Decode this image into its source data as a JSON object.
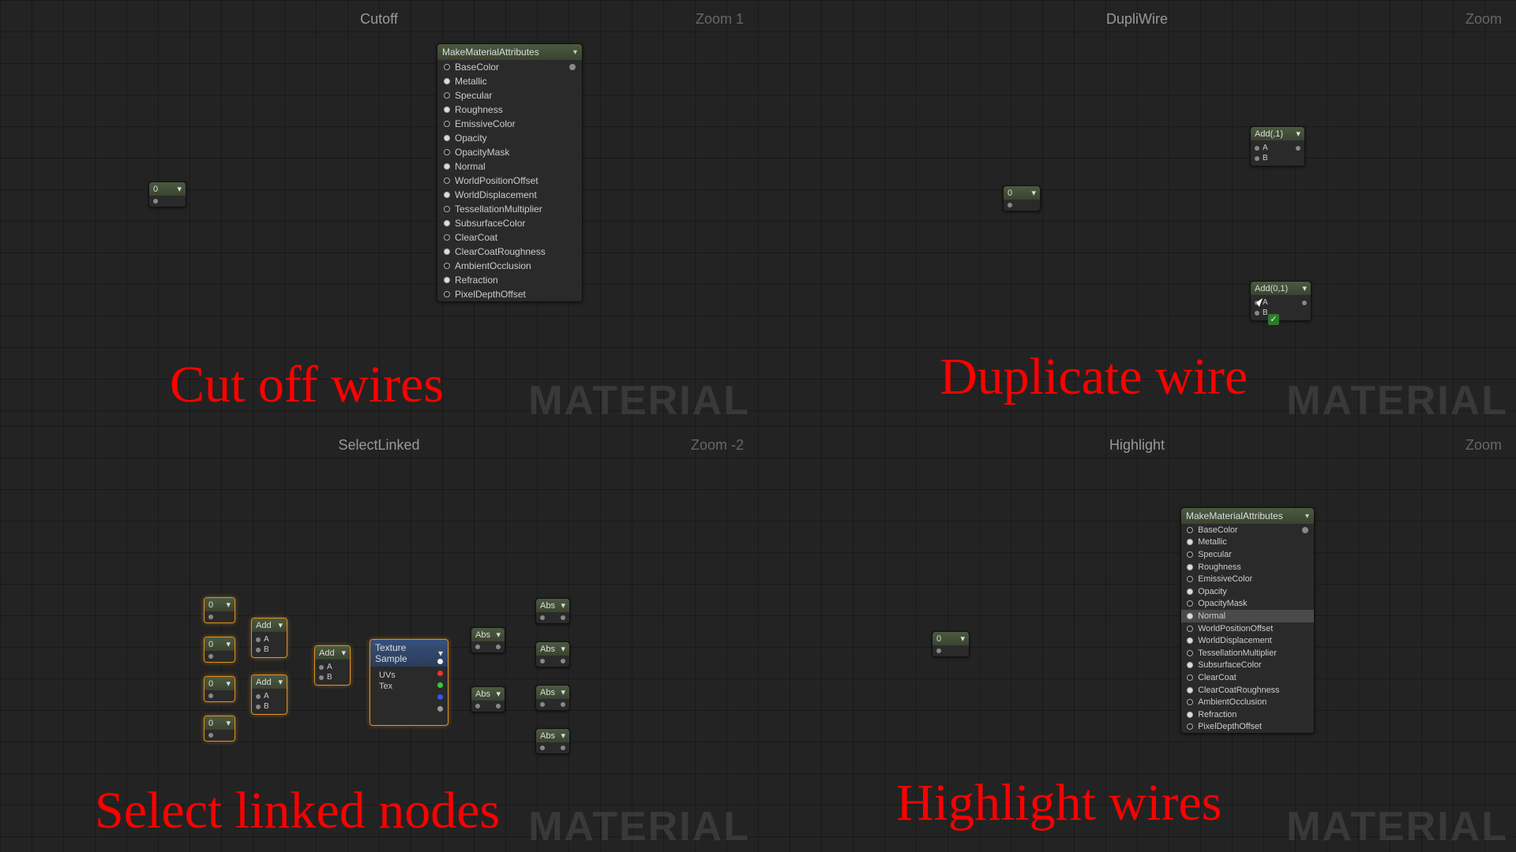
{
  "watermark": "MATERIAL",
  "quadrants": {
    "tl": {
      "title": "Cutoff",
      "zoom": "Zoom 1",
      "caption": "Cut off wires"
    },
    "tr": {
      "title": "DupliWire",
      "zoom": "Zoom",
      "caption": "Duplicate wire"
    },
    "bl": {
      "title": "SelectLinked",
      "zoom": "Zoom -2",
      "caption": "Select linked nodes"
    },
    "br": {
      "title": "Highlight",
      "zoom": "Zoom",
      "caption": "Highlight wires"
    }
  },
  "material_node": {
    "title": "MakeMaterialAttributes",
    "pins": [
      "BaseColor",
      "Metallic",
      "Specular",
      "Roughness",
      "EmissiveColor",
      "Opacity",
      "OpacityMask",
      "Normal",
      "WorldPositionOffset",
      "WorldDisplacement",
      "TessellationMultiplier",
      "SubsurfaceColor",
      "ClearCoat",
      "ClearCoatRoughness",
      "AmbientOcclusion",
      "Refraction",
      "PixelDepthOffset"
    ]
  },
  "highlight_pin": "Normal",
  "const_node": {
    "label": "0"
  },
  "add_node_1": {
    "title": "Add(,1)",
    "pins": [
      "A",
      "B"
    ]
  },
  "add_node_2": {
    "title": "Add(0,1)",
    "pins": [
      "A",
      "B"
    ]
  },
  "select_linked": {
    "const": "0",
    "add": "Add",
    "abs": "Abs",
    "texture_sample": {
      "title": "Texture Sample",
      "inputs": [
        "UVs",
        "Tex"
      ]
    }
  }
}
